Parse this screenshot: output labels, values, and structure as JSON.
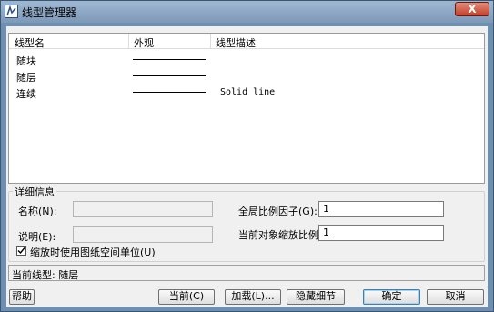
{
  "window": {
    "title": "线型管理器",
    "close_label": "X"
  },
  "list": {
    "headers": [
      "线型名",
      "外观",
      "线型描述"
    ],
    "rows": [
      {
        "name": "随块",
        "description": ""
      },
      {
        "name": "随层",
        "description": ""
      },
      {
        "name": "连续",
        "description": "Solid line"
      }
    ]
  },
  "details": {
    "title": "详细信息",
    "name_label": "名称(N):",
    "name_value": "",
    "desc_label": "说明(E):",
    "desc_value": "",
    "global_scale_label": "全局比例因子(G):",
    "global_scale_value": "1",
    "current_scale_label": "当前对象缩放比例(O):",
    "current_scale_value": "1",
    "paperspace_label": "缩放时使用图纸空间单位(U)",
    "paperspace_checked": true
  },
  "status": {
    "text": "当前线型: 随层"
  },
  "buttons": {
    "help": "帮助",
    "current": "当前(C)",
    "load": "加载(L)...",
    "hide_details": "隐藏细节",
    "ok": "确定",
    "cancel": "取消"
  }
}
